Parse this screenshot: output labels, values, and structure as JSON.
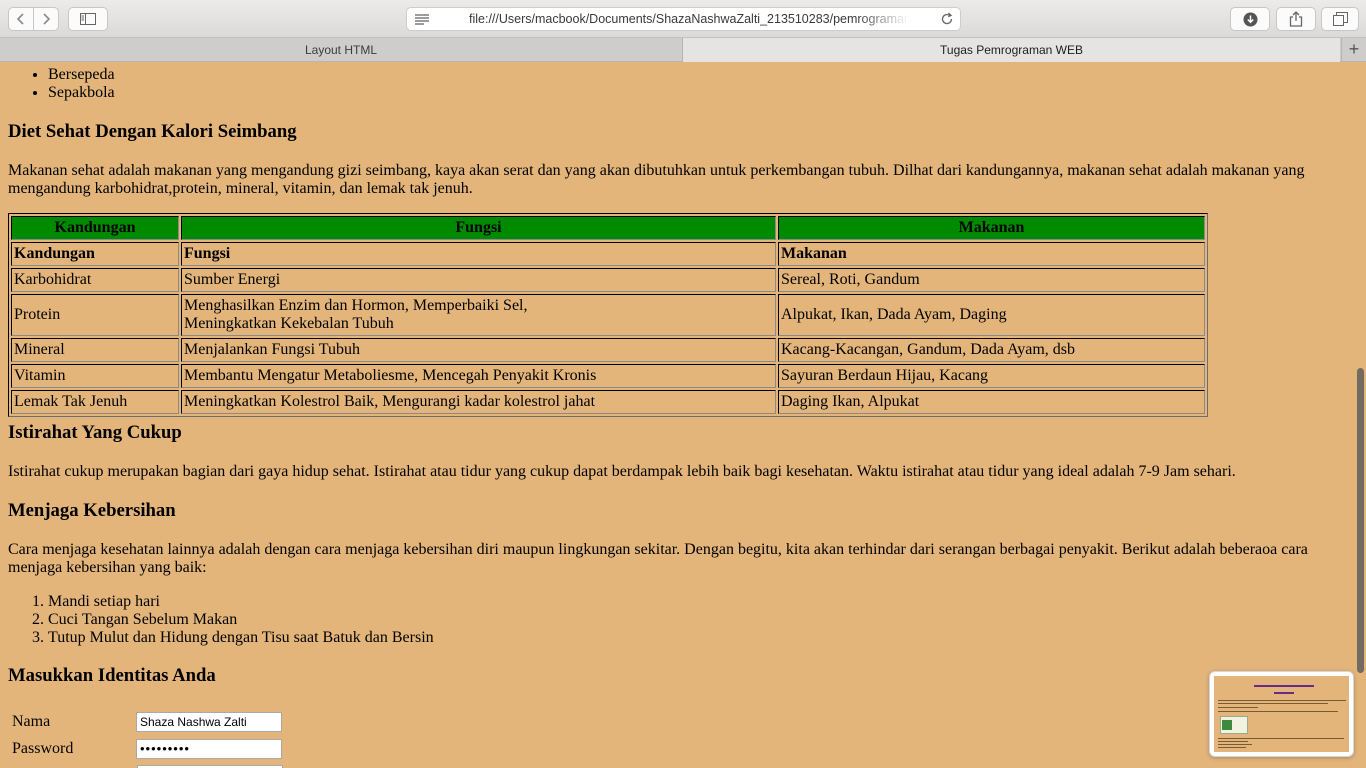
{
  "browser": {
    "url": "file:///Users/macbook/Documents/ShazaNashwaZalti_213510283/pemrograman",
    "tabs": [
      {
        "label": "Layout HTML",
        "active": false
      },
      {
        "label": "Tugas Pemrograman WEB",
        "active": true
      }
    ],
    "new_tab": "+"
  },
  "page": {
    "sport_list": [
      "Bersepeda",
      "Sepakbola"
    ],
    "diet": {
      "heading": "Diet Sehat Dengan Kalori Seimbang",
      "text": "Makanan sehat adalah makanan yang mengandung gizi seimbang, kaya akan serat dan yang akan dibutuhkan untuk perkembangan tubuh. Dilhat dari kandungannya, makanan sehat adalah makanan yang mengandung karbohidrat,protein, mineral, vitamin, dan lemak tak jenuh."
    },
    "table": {
      "header": [
        "Kandungan",
        "Fungsi",
        "Makanan"
      ],
      "rows": [
        [
          "Kandungan",
          "Fungsi",
          "Makanan"
        ],
        [
          "Karbohidrat",
          "Sumber Energi",
          "Sereal, Roti, Gandum"
        ],
        [
          "Protein",
          "Menghasilkan Enzim dan Hormon, Memperbaiki Sel,",
          "Alpukat, Ikan, Dada Ayam, Daging"
        ],
        [
          "Mineral",
          "Menjalankan Fungsi Tubuh",
          "Kacang-Kacangan, Gandum, Dada Ayam, dsb"
        ],
        [
          "Vitamin",
          "Membantu Mengatur Metaboliesme, Mencegah Penyakit Kronis",
          "Sayuran Berdaun Hijau, Kacang"
        ],
        [
          "Lemak Tak Jenuh",
          "Meningkatkan Kolestrol Baik, Mengurangi kadar kolestrol jahat",
          "Daging Ikan, Alpukat"
        ]
      ],
      "protein_line2": "Meningkatkan Kekebalan Tubuh",
      "header_color": "#008a00"
    },
    "rest": {
      "heading": "Istirahat Yang Cukup",
      "text": "Istirahat cukup merupakan bagian dari gaya hidup sehat. Istirahat atau tidur yang cukup dapat berdampak lebih baik bagi kesehatan. Waktu istirahat atau tidur yang ideal adalah 7-9 Jam sehari."
    },
    "clean": {
      "heading": "Menjaga Kebersihan",
      "text": "Cara menjaga kesehatan lainnya adalah dengan cara menjaga kebersihan diri maupun lingkungan sekitar. Dengan begitu, kita akan terhindar dari serangan berbagai penyakit. Berikut adalah beberaoa cara menjaga kebersihan yang baik:",
      "steps": [
        "Mandi setiap hari",
        "Cuci Tangan Sebelum Makan",
        "Tutup Mulut dan Hidung dengan Tisu saat Batuk dan Bersin"
      ]
    },
    "form": {
      "heading": "Masukkan Identitas Anda",
      "name_label": "Nama",
      "name_value": "Shaza Nashwa Zalti",
      "password_label": "Password",
      "password_value": "•••••••••"
    }
  },
  "colors": {
    "page_background": "#e3b57b",
    "table_header": "#008a00"
  }
}
